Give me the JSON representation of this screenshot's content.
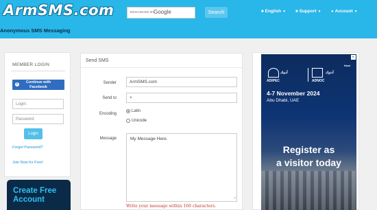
{
  "header": {
    "logo_text": "ArmSMS.com",
    "tagline": "Anonymous SMS Messaging",
    "search": {
      "enhanced_label": "ENHANCED BY",
      "brand": "Google",
      "button_label": "Search"
    },
    "nav": [
      {
        "label": "English",
        "icon": "comment-icon"
      },
      {
        "label": "Support",
        "icon": "comments-icon"
      },
      {
        "label": "Account",
        "icon": "user-icon"
      }
    ]
  },
  "login": {
    "title": "MEMBER LOGIN",
    "facebook_label_1": "Continue with",
    "facebook_label_2": "Facebook",
    "login_placeholder": "Login:",
    "password_placeholder": "Password:",
    "login_button": "Login",
    "forgot_link": "Forgot Password?",
    "join_link": "Join Now for Free!",
    "create_line1": "Create Free",
    "create_line2": "Account"
  },
  "send_sms": {
    "title": "Send SMS",
    "sender_label": "Sender",
    "sender_value": "ArmSMS.com",
    "sendto_label": "Send to",
    "sendto_value": "+",
    "encoding_label": "Encoding",
    "encoding_options": [
      {
        "label": "Latin",
        "selected": true
      },
      {
        "label": "Unicode",
        "selected": false
      }
    ],
    "message_label": "Message",
    "message_value": "My Message Here.",
    "hint": "Write your message within 160 characters."
  },
  "ad": {
    "adipec": "ADIPEC",
    "adipec_ar": "أديبك",
    "host": "Host",
    "adnoc": "ADNOC",
    "adnoc_ar": "أدنوك",
    "date": "4-7 November 2024",
    "city": "Abu Dhabi, UAE",
    "cta_line1": "Register as",
    "cta_line2": "a visitor today"
  },
  "colors": {
    "header": "#29b6e8",
    "facebook": "#2f6dc0",
    "button": "#52c0e8",
    "hint": "#c0392b",
    "ad_bg": "#0d2c5f"
  }
}
